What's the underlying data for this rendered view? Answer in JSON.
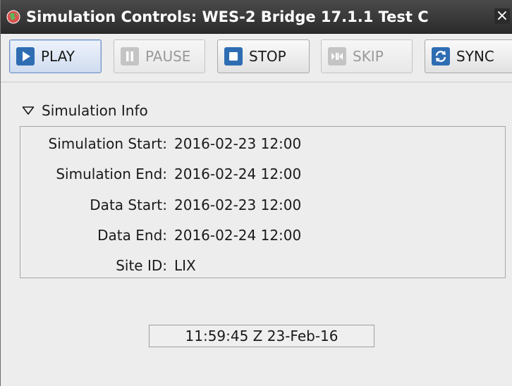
{
  "window": {
    "title": "Simulation Controls: WES-2 Bridge 17.1.1 Test C",
    "close_glyph": "×"
  },
  "toolbar": {
    "play_label": "PLAY",
    "pause_label": "PAUSE",
    "stop_label": "STOP",
    "skip_label": "SKIP",
    "sync_label": "SYNC"
  },
  "section": {
    "title": "Simulation Info"
  },
  "info": {
    "rows": [
      {
        "label": "Simulation Start:",
        "value": "2016-02-23 12:00"
      },
      {
        "label": "Simulation End:",
        "value": "2016-02-24 12:00"
      },
      {
        "label": "Data Start:",
        "value": "2016-02-23 12:00"
      },
      {
        "label": "Data End:",
        "value": "2016-02-24 12:00"
      },
      {
        "label": "Site ID:",
        "value": "LIX"
      }
    ]
  },
  "clock": {
    "text": "11:59:45 Z 23-Feb-16"
  },
  "colors": {
    "accent": "#2f6db3",
    "titlebar": "#333333"
  }
}
